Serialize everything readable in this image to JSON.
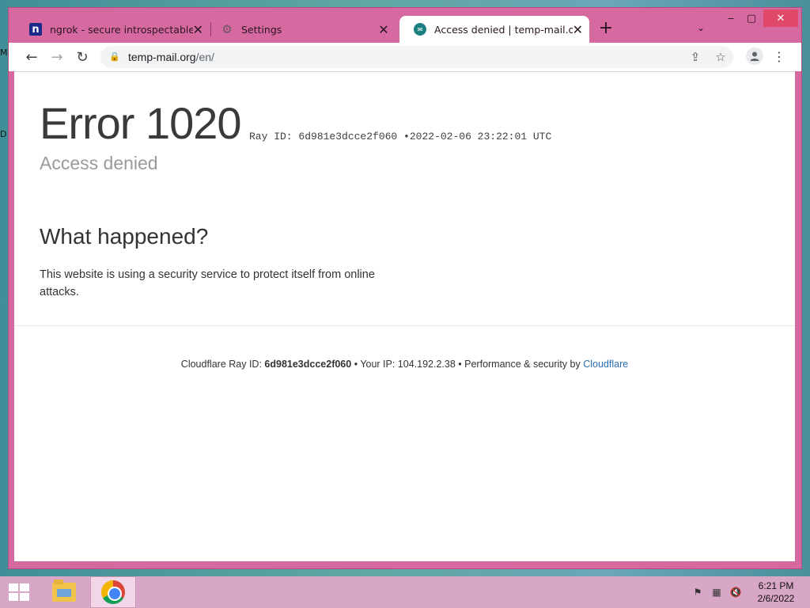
{
  "tabs": [
    {
      "title": "ngrok - secure introspectable tunnels to localhost",
      "icon": "ngrok-logo-icon"
    },
    {
      "title": "Settings",
      "icon": "gear-icon"
    },
    {
      "title": "Access denied | temp-mail.org used Cloudflare to restrict access",
      "icon": "temp-mail-logo-icon",
      "active": true
    }
  ],
  "toolbar": {
    "url_host": "temp-mail.org",
    "url_path": "/en/"
  },
  "page": {
    "error_title": "Error 1020",
    "ray_label": "Ray ID: 6d981e3dcce2f060",
    "ray_sep": "•",
    "timestamp": "2022-02-06 23:22:01 UTC",
    "subtitle": "Access denied",
    "section_heading": "What happened?",
    "explanation": "This website is using a security service to protect itself from online attacks.",
    "footer": {
      "ray_prefix": "Cloudflare Ray ID:",
      "ray_id": "6d981e3dcce2f060",
      "ip_text": "• Your IP: 104.192.2.38 •",
      "perf_text": "Performance & security by",
      "cf_link": "Cloudflare"
    }
  },
  "taskbar": {
    "time": "6:21 PM",
    "date": "2/6/2022"
  },
  "colors": {
    "window_frame": "#d66aa0",
    "close_button": "#e04a68",
    "link": "#2a6db0"
  }
}
